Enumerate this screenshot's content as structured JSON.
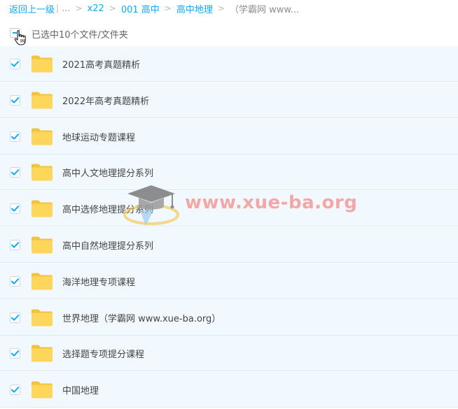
{
  "breadcrumb": {
    "back": "返回上一级",
    "sep1": "|",
    "ellipsis": "...",
    "items": [
      "x22",
      "001 高中",
      "高中地理"
    ],
    "current": "（学霸网 www...",
    "sep": ">"
  },
  "header": {
    "selection_text": "已选中10个文件/文件夹"
  },
  "files": [
    {
      "name": "2021高考真题精析",
      "checked": true
    },
    {
      "name": "2022年高考真题精析",
      "checked": true
    },
    {
      "name": "地球运动专题课程",
      "checked": true
    },
    {
      "name": "高中人文地理提分系列",
      "checked": true
    },
    {
      "name": "高中选修地理提分系列",
      "checked": true
    },
    {
      "name": "高中自然地理提分系列",
      "checked": true
    },
    {
      "name": "海洋地理专项课程",
      "checked": true
    },
    {
      "name": "世界地理（学霸网 www.xue-ba.org）",
      "checked": true
    },
    {
      "name": "选择题专项提分课程",
      "checked": true
    },
    {
      "name": "中国地理",
      "checked": true
    }
  ],
  "watermark": {
    "text": "www.xue-ba.org"
  },
  "colors": {
    "accent": "#09aaff",
    "row_bg": "#f1f8fe",
    "folder": "#ffd65c",
    "watermark": "#f2a8a6"
  }
}
